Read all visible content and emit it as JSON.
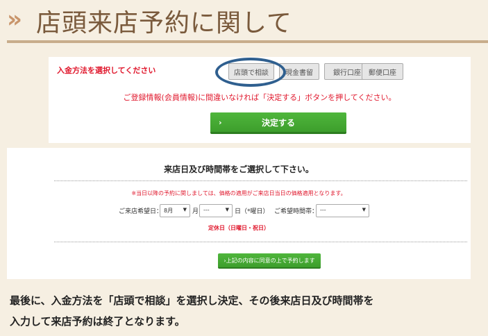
{
  "header": {
    "chevron": "»",
    "title": "店頭来店予約に関して"
  },
  "payment": {
    "label": "入金方法を選択してください",
    "methods": [
      "店頭で相談",
      "現金書留",
      "銀行口座",
      "郵便口座"
    ],
    "selected": "店頭で相談",
    "note": "ご登録情報(会員情報)に間違いなければ「決定する」ボタンを押してください。",
    "confirm_arrow": "›",
    "confirm_label": "決定する"
  },
  "visit": {
    "title": "来店日及び時間帯をご選択して下さい。",
    "note": "※当日以降の予約に関しましては、価格の適用がご来店日当日の価格適用となります。",
    "date_label": "ご来店希望日：",
    "month_value": "8月",
    "month_unit": "月",
    "day_value": "---",
    "day_unit": "日（*曜日）",
    "time_label": "ご希望時間帯：",
    "time_value": "---",
    "closed_note": "定休日（日曜日・祝日）",
    "reserve_label": "›上記の内容に同意の上で予約します"
  },
  "summary": {
    "line1": "最後に、入金方法を「店頭で相談」を選択し決定、その後来店日及び時間帯を",
    "line2": "入力して来店予約は終了となります。"
  },
  "colors": {
    "accent_red": "#e0182d",
    "button_green": "#45a934",
    "highlight_ring": "#2f5f8f",
    "title_brown": "#7a5a3c"
  }
}
